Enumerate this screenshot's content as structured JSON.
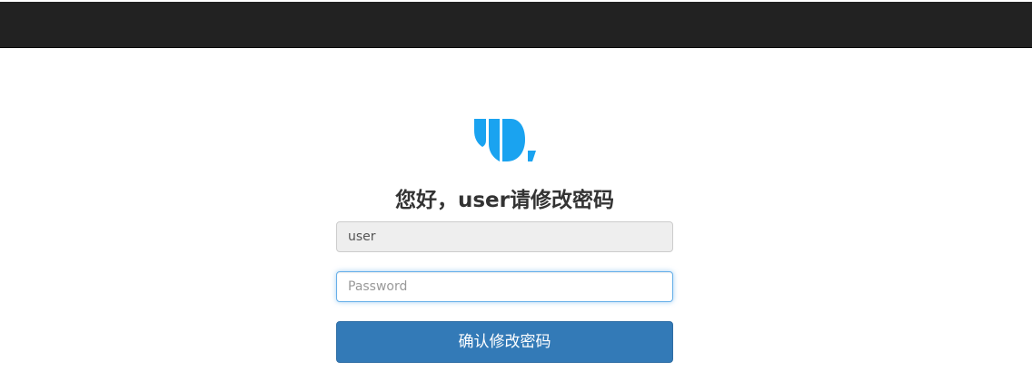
{
  "brand": {
    "logo_icon": "brand-logo-icon",
    "accent_color": "#1aa3f0"
  },
  "form": {
    "title": "您好，user请修改密码",
    "username_value": "user",
    "password_placeholder": "Password",
    "submit_label": "确认修改密码"
  },
  "colors": {
    "topbar": "#222222",
    "button": "#337ab7",
    "readonly_field": "#eeeeee",
    "focus_border": "#66afe9"
  }
}
